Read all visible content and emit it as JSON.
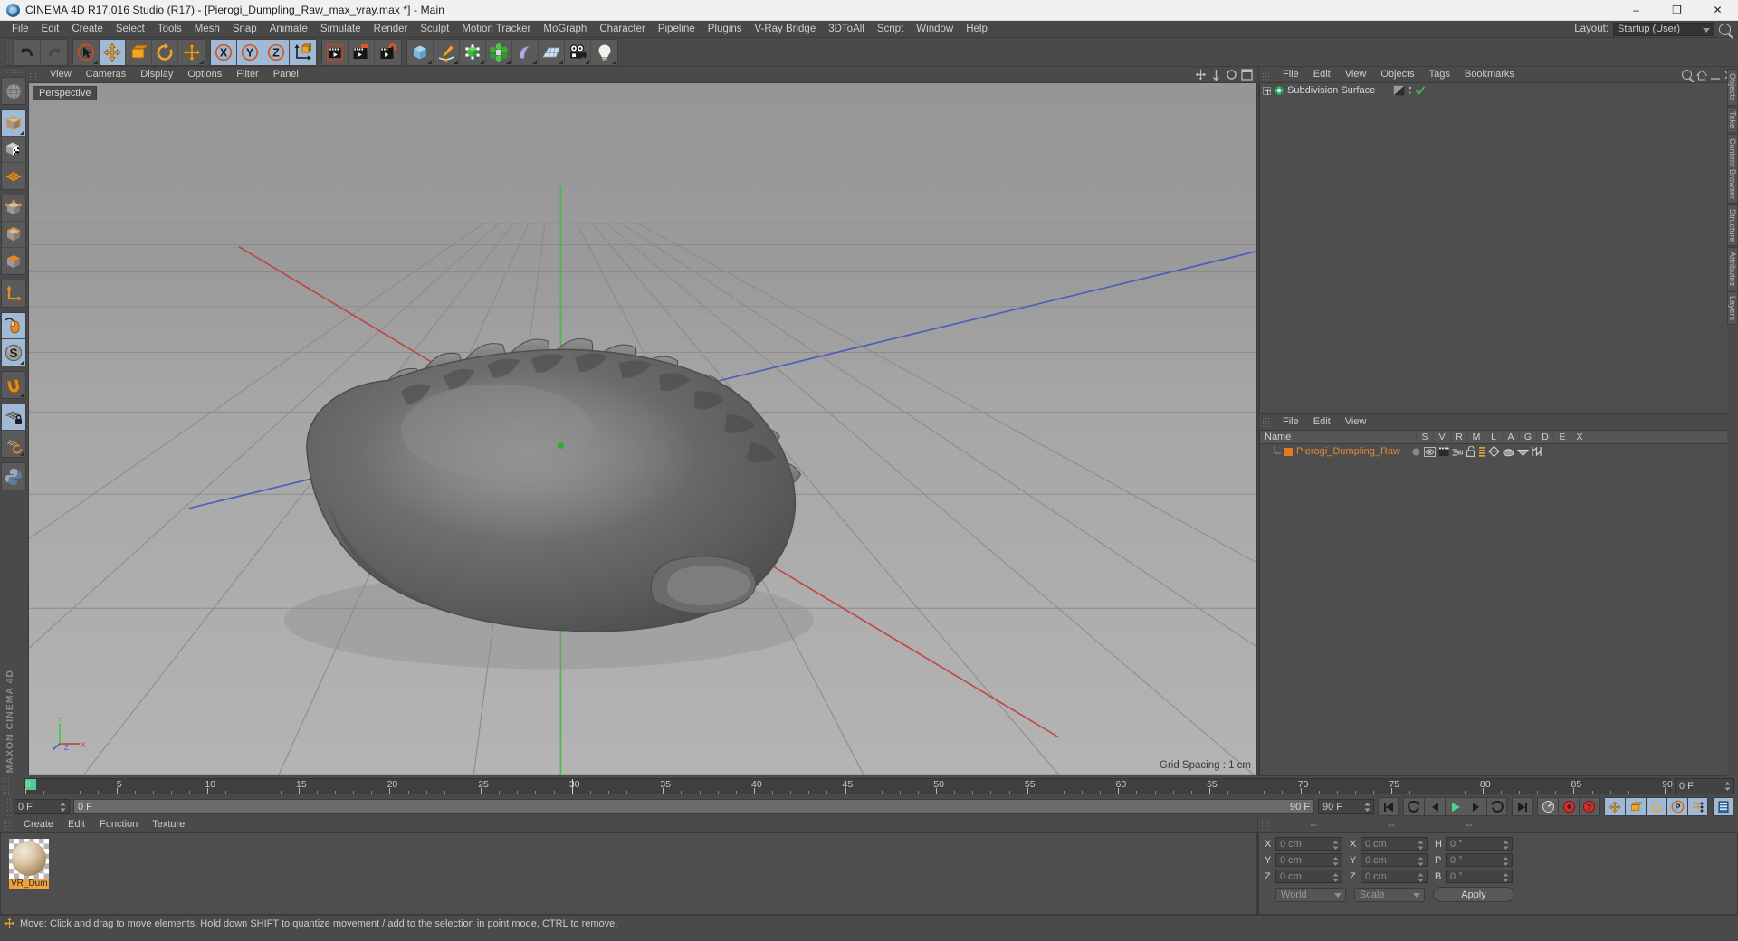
{
  "window": {
    "title": "CINEMA 4D R17.016 Studio (R17) - [Pierogi_Dumpling_Raw_max_vray.max *] - Main",
    "app_icon": "cinema4d-logo-icon",
    "minimize": "–",
    "maximize": "❐",
    "close": "✕"
  },
  "menubar": {
    "items": [
      "File",
      "Edit",
      "Create",
      "Select",
      "Tools",
      "Mesh",
      "Snap",
      "Animate",
      "Simulate",
      "Render",
      "Sculpt",
      "Motion Tracker",
      "MoGraph",
      "Character",
      "Pipeline",
      "Plugins",
      "V-Ray Bridge",
      "3DToAll",
      "Script",
      "Window",
      "Help"
    ],
    "layout_label": "Layout:",
    "layout_value": "Startup (User)"
  },
  "toolbar": {
    "groups": [
      {
        "name": "history",
        "buttons": [
          {
            "name": "undo-button",
            "icon": "undo-arrow-icon",
            "active": false,
            "corner": false
          },
          {
            "name": "redo-button",
            "icon": "redo-arrow-icon",
            "active": false,
            "corner": false
          }
        ]
      },
      {
        "name": "tools",
        "buttons": [
          {
            "name": "live-selection-tool",
            "icon": "cursor-circle-icon",
            "active": false,
            "corner": true
          },
          {
            "name": "move-tool",
            "icon": "move-arrows-icon",
            "active": true,
            "corner": false
          },
          {
            "name": "scale-tool",
            "icon": "scale-box-icon",
            "active": false,
            "corner": false
          },
          {
            "name": "rotate-tool",
            "icon": "rotate-circle-icon",
            "active": false,
            "corner": false
          },
          {
            "name": "transform-tool",
            "icon": "move-arrows-icon",
            "active": false,
            "corner": true
          }
        ]
      },
      {
        "name": "axis-locks",
        "buttons": [
          {
            "name": "lock-x-axis",
            "icon": "x-axis-icon",
            "active": true,
            "corner": false
          },
          {
            "name": "lock-y-axis",
            "icon": "y-axis-icon",
            "active": true,
            "corner": false
          },
          {
            "name": "lock-z-axis",
            "icon": "z-axis-icon",
            "active": true,
            "corner": false
          },
          {
            "name": "world-object-coordinate-toggle",
            "icon": "world-axis-cube-icon",
            "active": true,
            "corner": false
          }
        ]
      },
      {
        "name": "render",
        "buttons": [
          {
            "name": "render-view-button",
            "icon": "render-clapper-icon",
            "active": false,
            "corner": false
          },
          {
            "name": "render-to-picture-viewer-button",
            "icon": "render-picture-icon",
            "active": false,
            "corner": false
          },
          {
            "name": "render-settings-button",
            "icon": "render-gear-icon",
            "active": false,
            "corner": false
          }
        ]
      },
      {
        "name": "primitives",
        "buttons": [
          {
            "name": "add-cube-button",
            "icon": "cube-icon",
            "active": false,
            "corner": true
          },
          {
            "name": "add-spline-button",
            "icon": "pen-spline-icon",
            "active": false,
            "corner": true
          },
          {
            "name": "add-generator-button",
            "icon": "nurbs-cube-icon",
            "active": false,
            "corner": true
          },
          {
            "name": "add-modeling-object-button",
            "icon": "atom-green-icon",
            "active": false,
            "corner": true
          },
          {
            "name": "add-deformer-button",
            "icon": "bend-deformer-icon",
            "active": false,
            "corner": true
          },
          {
            "name": "add-environment-button",
            "icon": "floor-grid-icon",
            "active": false,
            "corner": true
          },
          {
            "name": "add-camera-button",
            "icon": "camera-icon",
            "active": false,
            "corner": true
          },
          {
            "name": "add-light-button",
            "icon": "light-bulb-icon",
            "active": false,
            "corner": true
          }
        ]
      }
    ]
  },
  "leftbar": {
    "buttons": [
      {
        "name": "texture-axis-mode",
        "icon": "globe-wire-icon",
        "active": false,
        "corner": false
      },
      {
        "name": "model-mode",
        "icon": "cube-orange-edge-icon",
        "active": true,
        "corner": true
      },
      {
        "name": "texture-mode",
        "icon": "cube-checker-icon",
        "active": false,
        "corner": false
      },
      {
        "name": "workplane-mode",
        "icon": "grid-plane-orange-icon",
        "active": false,
        "corner": false
      },
      {
        "name": "points-mode",
        "icon": "points-cube-icon",
        "active": false,
        "corner": false
      },
      {
        "name": "edges-mode",
        "icon": "edges-cube-icon",
        "active": false,
        "corner": false
      },
      {
        "name": "polygons-mode",
        "icon": "polygons-cube-icon",
        "active": false,
        "corner": false
      },
      {
        "name": "object-axis-mode",
        "icon": "axis-corner-icon",
        "active": false,
        "corner": false
      },
      {
        "name": "enable-axis-modification",
        "icon": "mouse-axis-icon",
        "active": true,
        "corner": false
      },
      {
        "name": "viewport-solo-mode",
        "icon": "s-sphere-icon",
        "active": true,
        "corner": true
      },
      {
        "name": "enable-snapping",
        "icon": "magnet-icon",
        "active": false,
        "corner": true
      },
      {
        "name": "lock-workplane",
        "icon": "workplane-lock-icon",
        "active": true,
        "corner": false
      },
      {
        "name": "workplane-rotate",
        "icon": "workplane-rotate-icon",
        "active": false,
        "corner": true
      },
      {
        "name": "python-script",
        "icon": "python-icon",
        "active": false,
        "corner": false
      }
    ],
    "brand": "MAXON CINEMA 4D"
  },
  "viewport": {
    "menus": [
      "View",
      "Cameras",
      "Display",
      "Options",
      "Filter",
      "Panel"
    ],
    "view_label": "Perspective",
    "grid_spacing": "Grid Spacing : 1 cm",
    "axis_labels": {
      "x": "X",
      "y": "Y",
      "z": "Z"
    },
    "scene_object": "Pierogi dumpling mesh (shaded gray)"
  },
  "object_manager": {
    "menus": [
      "File",
      "Edit",
      "View",
      "Objects",
      "Tags",
      "Bookmarks"
    ],
    "items": [
      {
        "name": "Subdivision Surface",
        "icon": "subdivision-surface-icon",
        "expandable": true,
        "tags": [
          "phong-tag-icon",
          "visibility-dots-icon",
          "green-check-icon"
        ]
      }
    ]
  },
  "lower_manager": {
    "menus": [
      "File",
      "Edit",
      "View"
    ],
    "columns": [
      "Name",
      "S",
      "V",
      "R",
      "M",
      "L",
      "A",
      "G",
      "D",
      "E",
      "X"
    ],
    "rows": [
      {
        "name": "Pierogi_Dumpling_Raw",
        "color_swatch": "#e07b1f",
        "icons": [
          "dot-icon",
          "eye-icon",
          "render-clapper-icon",
          "layer-icon",
          "unlock-icon",
          "list-icon",
          "generator-icon",
          "deform-icon",
          "display-icon",
          "xref-icon"
        ]
      }
    ]
  },
  "timeline": {
    "start_frame": "0 F",
    "end_frame": "90 F",
    "current_frame": "0 F",
    "range_start": "0 F",
    "range_end": "90 F",
    "ticks": [
      0,
      5,
      10,
      15,
      20,
      25,
      30,
      35,
      40,
      45,
      50,
      55,
      60,
      65,
      70,
      75,
      80,
      85,
      90
    ],
    "playhead_frame": 0,
    "green_marker_color": "#4ccf8e"
  },
  "transport": {
    "buttons": [
      {
        "name": "go-to-start-button",
        "icon": "skip-start-icon",
        "active": false
      },
      {
        "name": "go-to-previous-key-button",
        "icon": "prev-key-icon",
        "active": false
      },
      {
        "name": "go-to-previous-frame-button",
        "icon": "step-back-icon",
        "active": false
      },
      {
        "name": "play-button",
        "icon": "play-icon",
        "active": false
      },
      {
        "name": "go-to-next-frame-button",
        "icon": "step-forward-icon",
        "active": false
      },
      {
        "name": "go-to-next-key-button",
        "icon": "next-key-icon",
        "active": false
      },
      {
        "name": "go-to-end-button",
        "icon": "skip-end-icon",
        "active": false
      },
      {
        "name": "record-active-objects-button",
        "icon": "record-gauge-icon",
        "active": false
      },
      {
        "name": "autokeying-button",
        "icon": "record-red-icon",
        "active": false
      },
      {
        "name": "keyframe-selection-button",
        "icon": "key-question-icon",
        "active": false
      },
      {
        "name": "position-key-toggle",
        "icon": "move-arrows-icon",
        "active": true
      },
      {
        "name": "scale-key-toggle",
        "icon": "scale-box-icon",
        "active": true
      },
      {
        "name": "rotation-key-toggle",
        "icon": "rotate-circle-icon",
        "active": true
      },
      {
        "name": "parameter-key-toggle",
        "icon": "param-p-icon",
        "active": true
      },
      {
        "name": "point-level-animation-toggle",
        "icon": "pla-dots-icon",
        "active": true
      },
      {
        "name": "timeline-toggle",
        "icon": "timeline-strip-icon",
        "active": true
      }
    ]
  },
  "material_manager": {
    "menus": [
      "Create",
      "Edit",
      "Function",
      "Texture"
    ],
    "materials": [
      {
        "name": "VR_Dum",
        "full_name": "VR_Dumpling",
        "preview": "beige-sphere-preview",
        "selected": true
      }
    ]
  },
  "coordinates": {
    "header_labels": [
      "--",
      "--",
      "--"
    ],
    "rows": [
      {
        "pos_label": "X",
        "pos_value": "0 cm",
        "size_label": "X",
        "size_value": "0 cm",
        "rot_label": "H",
        "rot_value": "0 °"
      },
      {
        "pos_label": "Y",
        "pos_value": "0 cm",
        "size_label": "Y",
        "size_value": "0 cm",
        "rot_label": "P",
        "rot_value": "0 °"
      },
      {
        "pos_label": "Z",
        "pos_value": "0 cm",
        "size_label": "Z",
        "size_value": "0 cm",
        "rot_label": "B",
        "rot_value": "0 °"
      }
    ],
    "coord_system": "World",
    "transform_mode": "Scale",
    "apply_label": "Apply"
  },
  "statusbar": {
    "text": "Move: Click and drag to move elements. Hold down SHIFT to quantize movement / add to the selection in point mode, CTRL to remove."
  },
  "right_tabs": [
    "Objects",
    "Take",
    "Content Browser",
    "Structure",
    "Attributes",
    "Layers"
  ],
  "colors": {
    "accent_orange": "#e07b1f",
    "active_blue": "#9fb9d6",
    "panel_bg": "#4a4a4a",
    "field_bg": "#434343",
    "green_marker": "#4ccf8e",
    "axis_x": "#c83b3b",
    "axis_y": "#3bc83b",
    "axis_z": "#3b5fc8"
  }
}
